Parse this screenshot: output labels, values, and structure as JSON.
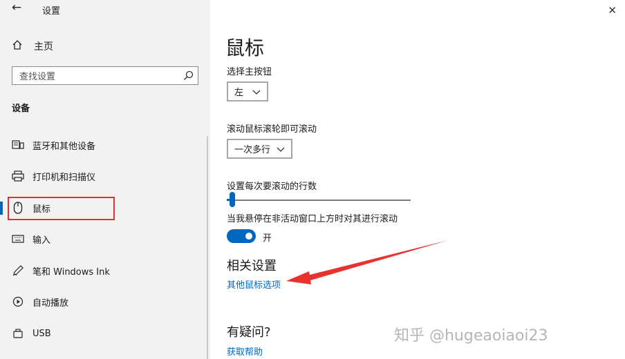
{
  "window": {
    "title": "设置",
    "back_icon": "arrow-left-icon",
    "close_icon": "close-icon"
  },
  "sidebar": {
    "home_label": "主页",
    "search_placeholder": "查找设置",
    "section": "设备",
    "items": [
      {
        "label": "蓝牙和其他设备",
        "icon": "bluetooth-devices-icon"
      },
      {
        "label": "打印机和扫描仪",
        "icon": "printer-icon"
      },
      {
        "label": "鼠标",
        "icon": "mouse-icon",
        "selected": true
      },
      {
        "label": "输入",
        "icon": "keyboard-icon"
      },
      {
        "label": "笔和 Windows Ink",
        "icon": "pen-icon"
      },
      {
        "label": "自动播放",
        "icon": "autoplay-icon"
      },
      {
        "label": "USB",
        "icon": "usb-icon"
      }
    ]
  },
  "main": {
    "title": "鼠标",
    "primary_button": {
      "label": "选择主按钮",
      "value": "左"
    },
    "scroll_mode": {
      "label": "滚动鼠标滚轮即可滚动",
      "value": "一次多行"
    },
    "lines_slider": {
      "label": "设置每次要滚动的行数",
      "value_fraction": 0.03
    },
    "inactive_scroll": {
      "label": "当我悬停在非活动窗口上方时对其进行滚动",
      "state": "开",
      "on": true
    },
    "related": {
      "header": "相关设置",
      "link": "其他鼠标选项"
    },
    "help": {
      "header": "有疑问?",
      "link": "获取帮助"
    }
  },
  "watermark": "知乎 @hugeaoiaoi23",
  "colors": {
    "accent": "#0067c0",
    "highlight_box": "#d9312e",
    "arrow": "#e8322d"
  }
}
